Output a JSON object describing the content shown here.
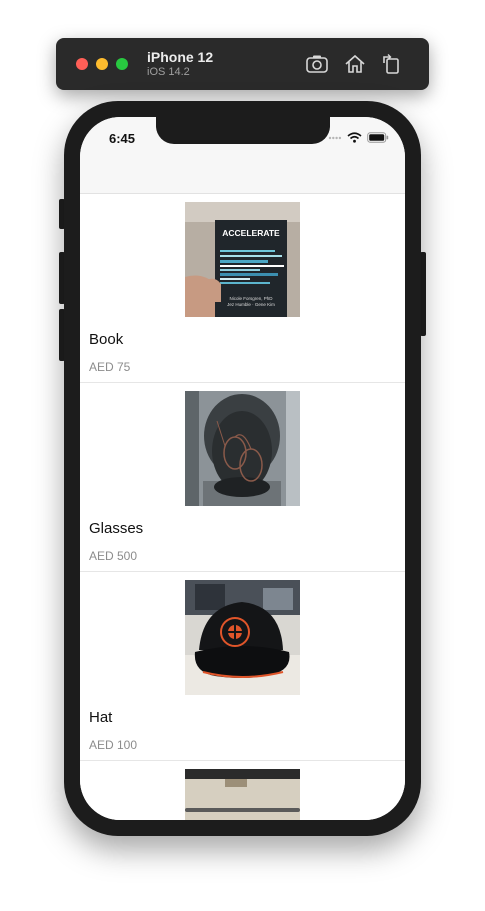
{
  "simulator": {
    "device": "iPhone 12",
    "os": "iOS 14.2",
    "buttons": [
      "screenshot-icon",
      "home-icon",
      "rotate-icon"
    ]
  },
  "status_bar": {
    "time": "6:45"
  },
  "products": [
    {
      "name": "Book",
      "price": "AED 75",
      "image_icon": "book-image"
    },
    {
      "name": "Glasses",
      "price": "AED 500",
      "image_icon": "glasses-image"
    },
    {
      "name": "Hat",
      "price": "AED 100",
      "image_icon": "hat-image"
    }
  ]
}
